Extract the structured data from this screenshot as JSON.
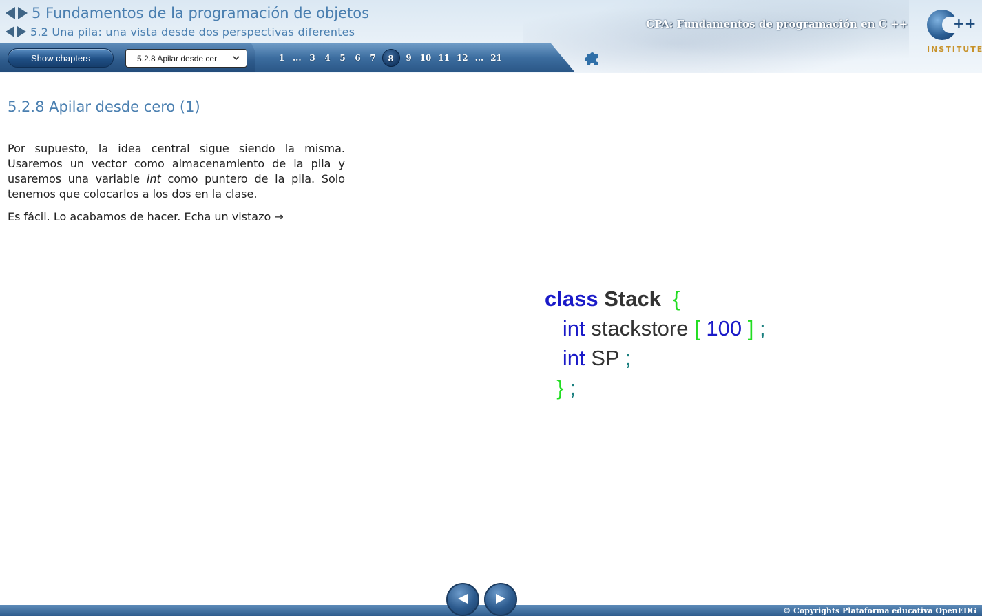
{
  "header": {
    "chapter_title": "5 Fundamentos de la programación de objetos",
    "section_title": "5.2 Una pila: una vista desde dos perspectivas diferentes",
    "course_title": "CPA: Fundamentos de programación en C ++",
    "logo_text": "INSTITUTE",
    "logo_plus": "++"
  },
  "toolbar": {
    "show_chapters_label": "Show chapters",
    "select_value": "5.2.8 Apilar desde cer",
    "select_icon": "chevron-down-icon",
    "pages": [
      "1",
      "...",
      "3",
      "4",
      "5",
      "6",
      "7",
      "8",
      "9",
      "10",
      "11",
      "12",
      "...",
      "21"
    ],
    "current_page": "8",
    "puzzle_icon": "puzzle-icon"
  },
  "content": {
    "title": "5.2.8 Apilar desde cero (1)",
    "para1_a": "Por supuesto, la idea central sigue siendo la misma. Usaremos un vector como almacenamiento de la pila y usaremos una variable ",
    "para1_em": "int",
    "para1_b": " como puntero de la pila. Solo tenemos que colocarlos a los dos en la clase.",
    "para2": "Es fácil. Lo acabamos de hacer. Echa un vistazo →"
  },
  "code": {
    "kw_class": "class",
    "class_name": "Stack",
    "open_brace": "{",
    "kw_int1": "int",
    "id_stackstore": "stackstore",
    "lbracket": "[",
    "size": "100",
    "rbracket": "]",
    "semi1": ";",
    "kw_int2": "int",
    "id_sp": "SP",
    "semi2": ";",
    "close_brace": "}",
    "semi3": ";"
  },
  "footer": {
    "prev_icon": "prev-arrow-icon",
    "next_icon": "next-arrow-icon",
    "copyright": "© Copyrights Plataforma educativa OpenEDG"
  },
  "colors": {
    "accent_blue": "#4a7fb0",
    "toolbar_dark": "#2a5686",
    "code_keyword": "#1a1ac8",
    "code_bracket": "#22dd22",
    "code_semicolon": "#1a7f7f"
  }
}
